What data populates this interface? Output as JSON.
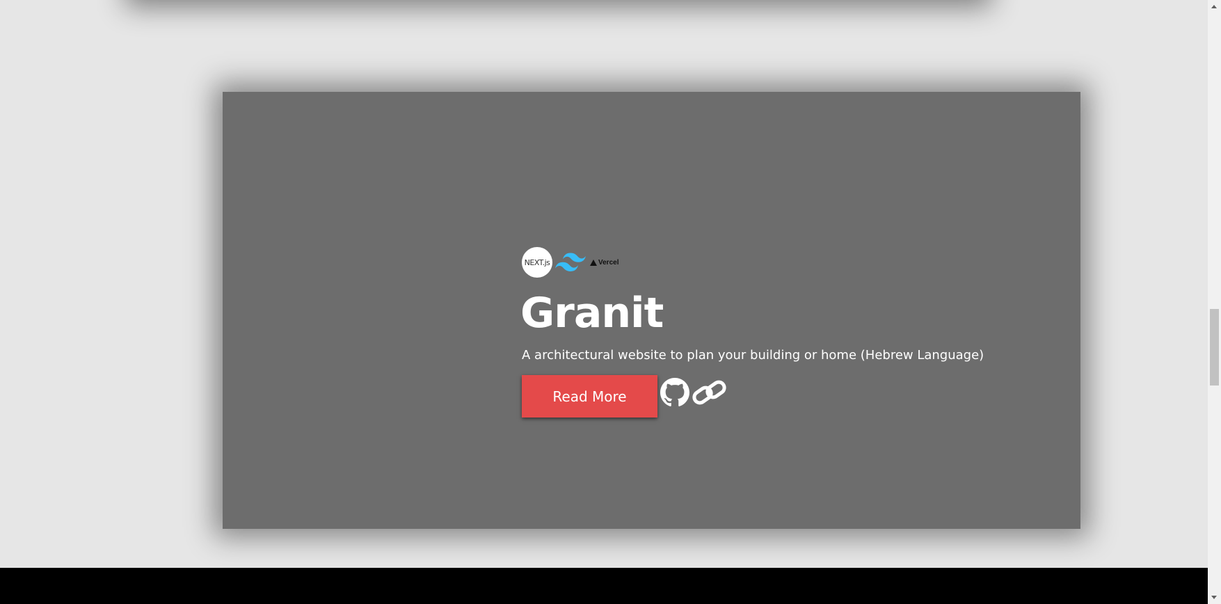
{
  "project": {
    "title": "Granit",
    "description": "A architectural website to plan your building or home (Hebrew Language)",
    "read_more_label": "Read More",
    "tech": {
      "next_label": "NEXT.js",
      "vercel_label": "Vercel"
    },
    "icons": {
      "github": "github-icon",
      "link": "link-icon",
      "tailwind": "tailwind-logo",
      "next": "nextjs-logo",
      "vercel": "vercel-logo"
    }
  },
  "colors": {
    "background": "#e6e6e6",
    "card": "#6d6d6d",
    "accent": "#e44a4a",
    "tailwind": "#38bdf8",
    "footer": "#000000"
  },
  "scroll": {
    "position_fraction": 0.58
  }
}
